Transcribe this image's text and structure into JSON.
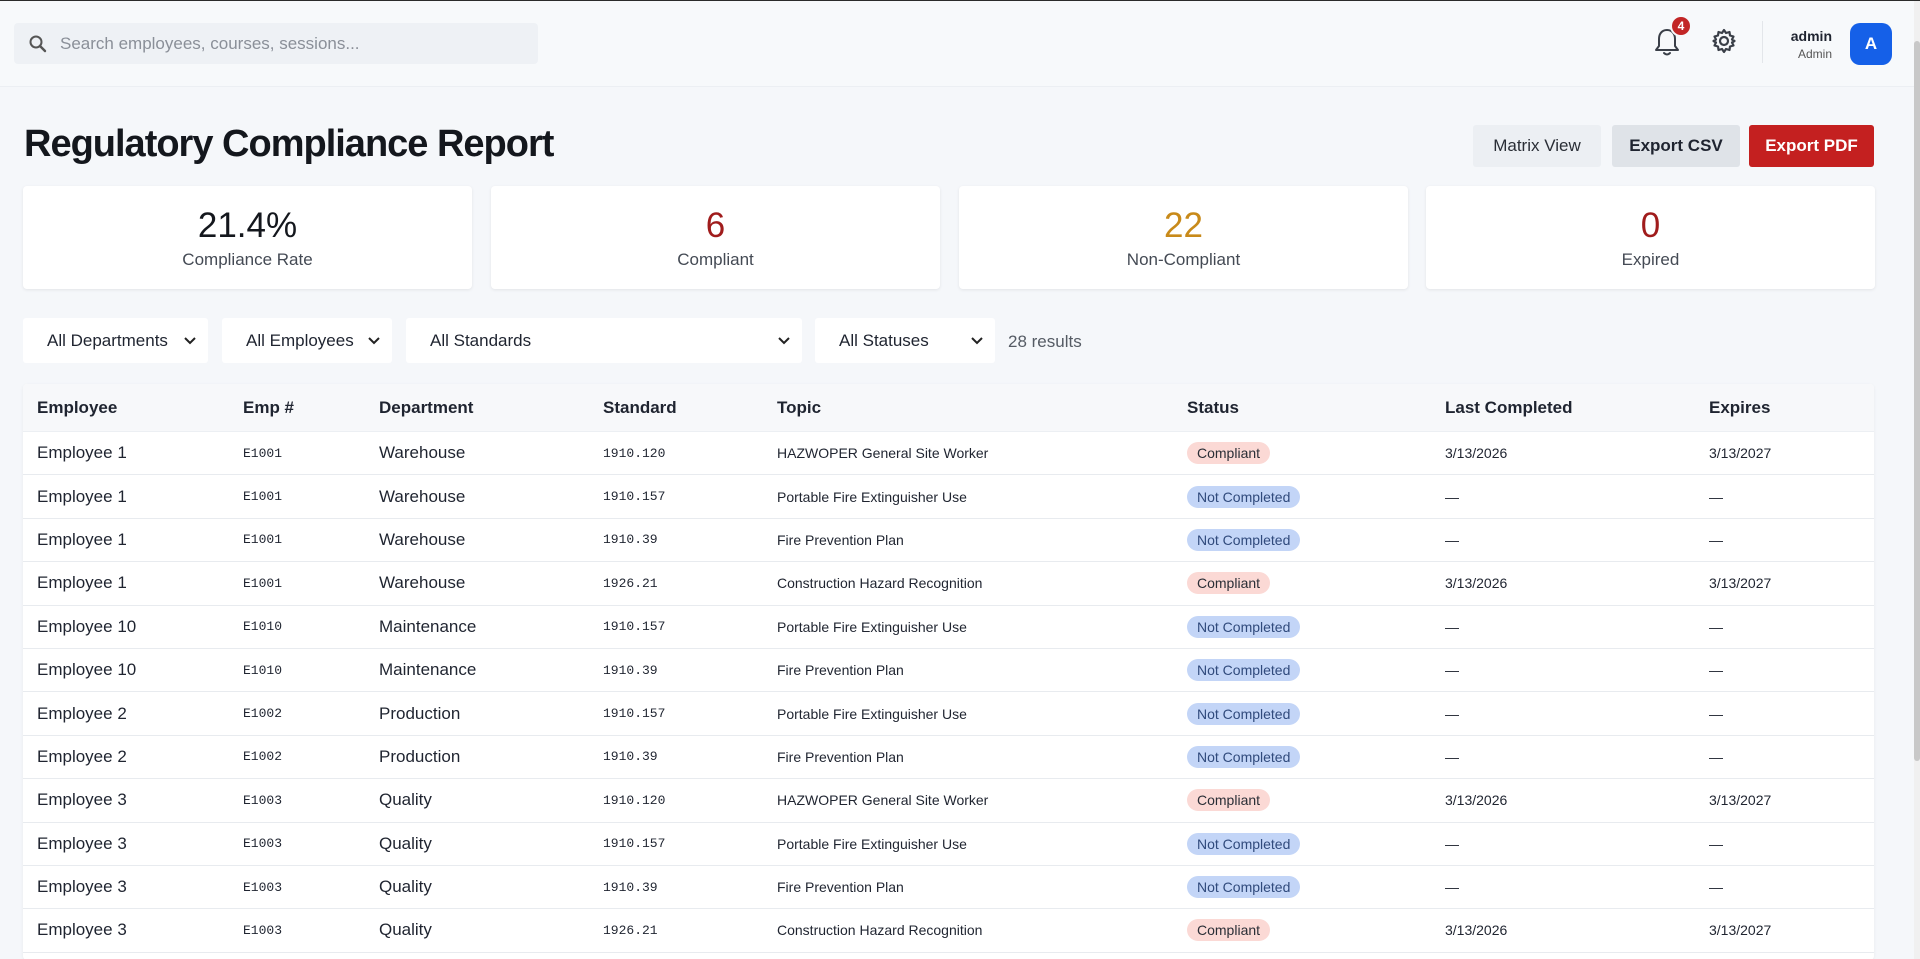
{
  "search": {
    "placeholder": "Search employees, courses, sessions..."
  },
  "notifications": {
    "count": "4"
  },
  "user": {
    "name": "admin",
    "role": "Admin",
    "initial": "A"
  },
  "page": {
    "title": "Regulatory Compliance Report"
  },
  "actions": {
    "matrix": "Matrix View",
    "csv": "Export CSV",
    "pdf": "Export PDF"
  },
  "colors": {
    "compliant_value": "#a01c1c",
    "noncompliant_value": "#c88a1a",
    "expired_value": "#a01c1c",
    "pdf_button": "#c42020",
    "avatar": "#1560e8"
  },
  "stats": [
    {
      "value": "21.4%",
      "label": "Compliance Rate"
    },
    {
      "value": "6",
      "label": "Compliant"
    },
    {
      "value": "22",
      "label": "Non-Compliant"
    },
    {
      "value": "0",
      "label": "Expired"
    }
  ],
  "filters": {
    "departments": "All Departments",
    "employees": "All Employees",
    "standards": "All Standards",
    "statuses": "All Statuses",
    "results": "28 results"
  },
  "table": {
    "headers": [
      "Employee",
      "Emp #",
      "Department",
      "Standard",
      "Topic",
      "Status",
      "Last Completed",
      "Expires"
    ],
    "rows": [
      [
        "Employee 1",
        "E1001",
        "Warehouse",
        "1910.120",
        "HAZWOPER General Site Worker",
        "Compliant",
        "3/13/2026",
        "3/13/2027"
      ],
      [
        "Employee 1",
        "E1001",
        "Warehouse",
        "1910.157",
        "Portable Fire Extinguisher Use",
        "Not Completed",
        "—",
        "—"
      ],
      [
        "Employee 1",
        "E1001",
        "Warehouse",
        "1910.39",
        "Fire Prevention Plan",
        "Not Completed",
        "—",
        "—"
      ],
      [
        "Employee 1",
        "E1001",
        "Warehouse",
        "1926.21",
        "Construction Hazard Recognition",
        "Compliant",
        "3/13/2026",
        "3/13/2027"
      ],
      [
        "Employee 10",
        "E1010",
        "Maintenance",
        "1910.157",
        "Portable Fire Extinguisher Use",
        "Not Completed",
        "—",
        "—"
      ],
      [
        "Employee 10",
        "E1010",
        "Maintenance",
        "1910.39",
        "Fire Prevention Plan",
        "Not Completed",
        "—",
        "—"
      ],
      [
        "Employee 2",
        "E1002",
        "Production",
        "1910.157",
        "Portable Fire Extinguisher Use",
        "Not Completed",
        "—",
        "—"
      ],
      [
        "Employee 2",
        "E1002",
        "Production",
        "1910.39",
        "Fire Prevention Plan",
        "Not Completed",
        "—",
        "—"
      ],
      [
        "Employee 3",
        "E1003",
        "Quality",
        "1910.120",
        "HAZWOPER General Site Worker",
        "Compliant",
        "3/13/2026",
        "3/13/2027"
      ],
      [
        "Employee 3",
        "E1003",
        "Quality",
        "1910.157",
        "Portable Fire Extinguisher Use",
        "Not Completed",
        "—",
        "—"
      ],
      [
        "Employee 3",
        "E1003",
        "Quality",
        "1910.39",
        "Fire Prevention Plan",
        "Not Completed",
        "—",
        "—"
      ],
      [
        "Employee 3",
        "E1003",
        "Quality",
        "1926.21",
        "Construction Hazard Recognition",
        "Compliant",
        "3/13/2026",
        "3/13/2027"
      ]
    ]
  }
}
